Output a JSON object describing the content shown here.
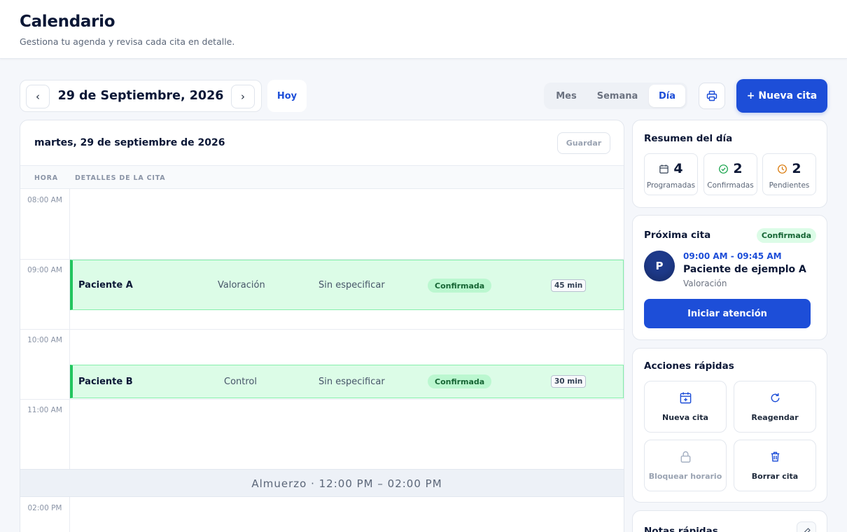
{
  "header": {
    "title": "Calendario",
    "subtitle": "Gestiona tu agenda y revisa cada cita en detalle."
  },
  "toolbar": {
    "prev_label": "‹",
    "next_label": "›",
    "current_date": "29 de Septiembre, 2026",
    "today_label": "Hoy",
    "views": [
      "Mes",
      "Semana",
      "Día"
    ],
    "active_view": "Día",
    "new_appointment_label": "+ Nueva cita"
  },
  "calendar": {
    "day_title": "martes, 29 de septiembre de 2026",
    "save_label": "Guardar",
    "columns": {
      "hour": "HORA",
      "details": "DETALLES DE LA CITA"
    },
    "hours": [
      "08:00 AM",
      "09:00 AM",
      "10:00 AM",
      "11:00 AM",
      "02:00 PM"
    ],
    "appointments": [
      {
        "patient": "Paciente A",
        "type": "Valoración",
        "detail": "Sin especificar",
        "status": "Confirmada",
        "duration": "45 min"
      },
      {
        "patient": "Paciente B",
        "type": "Control",
        "detail": "Sin especificar",
        "status": "Confirmada",
        "duration": "30 min"
      }
    ],
    "lunch_label": "Almuerzo · 12:00 PM – 02:00 PM"
  },
  "summary": {
    "title": "Resumen del día",
    "stats": [
      {
        "icon": "calendar-icon",
        "value": "4",
        "label": "Programadas"
      },
      {
        "icon": "check-circle-icon",
        "value": "2",
        "label": "Confirmadas"
      },
      {
        "icon": "clock-icon",
        "value": "2",
        "label": "Pendientes"
      }
    ]
  },
  "next_appointment": {
    "title": "Próxima cita",
    "status": "Confirmada",
    "avatar_initial": "P",
    "time": "09:00 AM - 09:45 AM",
    "patient": "Paciente de ejemplo A",
    "type": "Valoración",
    "start_label": "Iniciar atención"
  },
  "quick_actions": {
    "title": "Acciones rápidas",
    "items": [
      {
        "label": "Nueva cita",
        "icon": "calendar-plus-icon",
        "enabled": true
      },
      {
        "label": "Reagendar",
        "icon": "refresh-icon",
        "enabled": true
      },
      {
        "label": "Bloquear horario",
        "icon": "lock-icon",
        "enabled": false
      },
      {
        "label": "Borrar cita",
        "icon": "trash-icon",
        "enabled": true
      }
    ]
  },
  "quick_notes": {
    "title": "Notas rápidas"
  },
  "colors": {
    "primary": "#1d4ed8",
    "confirmed_bg": "#dcfce7",
    "confirmed_border": "#22c55e",
    "confirmed_text": "#166534",
    "pending_icon": "#d97706"
  }
}
